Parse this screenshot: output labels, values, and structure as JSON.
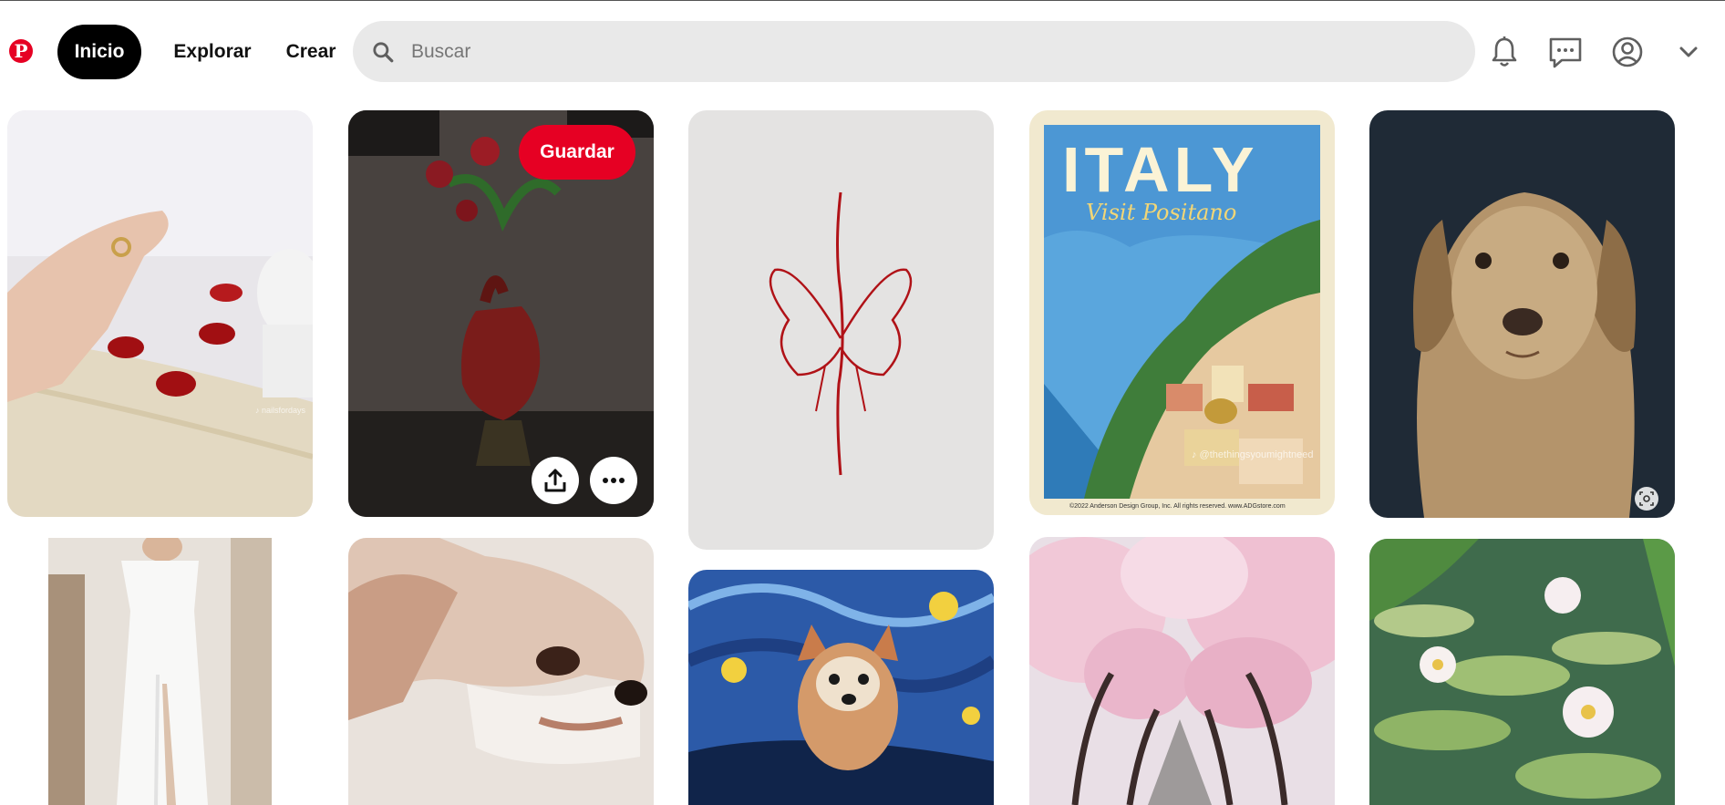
{
  "header": {
    "logo_letter": "P",
    "nav": {
      "home_label": "Inicio",
      "explore_label": "Explorar",
      "create_label": "Crear"
    },
    "search": {
      "placeholder": "Buscar",
      "value": ""
    },
    "icons": [
      "bell-icon",
      "messages-icon",
      "profile-icon",
      "chevron-down-icon"
    ]
  },
  "pins": [
    {
      "subject": "nails",
      "watermark": "♪ nailsfordays"
    },
    {
      "subject": "heart-vase",
      "save_label": "Guardar",
      "actions": [
        "share-icon",
        "more-icon"
      ]
    },
    {
      "subject": "butterfly-tattoo"
    },
    {
      "subject": "italy-poster",
      "title": "ITALY",
      "subtitle": "Visit Positano",
      "watermark": "♪ @thethingsyoumightneed",
      "credit": "©2022 Anderson Design Group, Inc. All rights reserved. www.ADGstore.com"
    },
    {
      "subject": "golden-retriever-painting",
      "action": "visual-search-icon"
    },
    {
      "subject": "white-dress"
    },
    {
      "subject": "chihuahua-illustration"
    },
    {
      "subject": "starry-night-chihuahua"
    },
    {
      "subject": "cherry-blossoms"
    },
    {
      "subject": "water-lilies"
    }
  ],
  "colors": {
    "brand": "#e60023",
    "search_bg": "#e9e9e9",
    "active_nav_bg": "#000000"
  }
}
